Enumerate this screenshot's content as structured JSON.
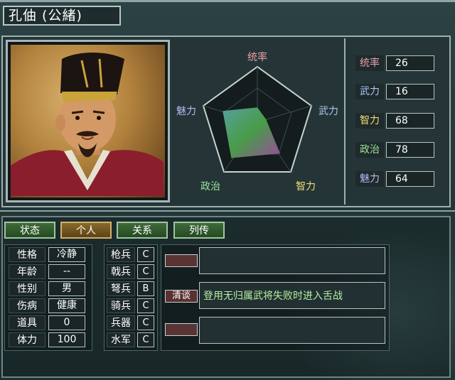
{
  "character": {
    "name": "孔伷 (公緒)"
  },
  "radar": {
    "axes": {
      "leadership": "统率",
      "war": "武力",
      "intelligence": "智力",
      "politics": "政治",
      "charm": "魅力"
    },
    "values": {
      "leadership": 26,
      "war": 16,
      "intelligence": 68,
      "politics": 78,
      "charm": 64
    }
  },
  "stats": [
    {
      "label": "统率",
      "value": "26",
      "color": "#e8a0a8"
    },
    {
      "label": "武力",
      "value": "16",
      "color": "#a8c8f0"
    },
    {
      "label": "智力",
      "value": "68",
      "color": "#f0dc78"
    },
    {
      "label": "政治",
      "value": "78",
      "color": "#9ee29a"
    },
    {
      "label": "魅力",
      "value": "64",
      "color": "#b7b7f0"
    }
  ],
  "tabs": [
    "状态",
    "个人",
    "关系",
    "列传"
  ],
  "active_tab": "个人",
  "personal": [
    {
      "label": "性格",
      "value": "冷静"
    },
    {
      "label": "年龄",
      "value": "--"
    },
    {
      "label": "性别",
      "value": "男"
    },
    {
      "label": "伤病",
      "value": "健康"
    },
    {
      "label": "道具",
      "value": "0"
    },
    {
      "label": "体力",
      "value": "100"
    }
  ],
  "units": [
    {
      "label": "枪兵",
      "value": "C"
    },
    {
      "label": "戟兵",
      "value": "C"
    },
    {
      "label": "弩兵",
      "value": "B"
    },
    {
      "label": "骑兵",
      "value": "C"
    },
    {
      "label": "兵器",
      "value": "C"
    },
    {
      "label": "水军",
      "value": "C"
    }
  ],
  "skills": [
    {
      "name": "",
      "description": ""
    },
    {
      "name": "清谈",
      "description": "登用无归属武将失败时进入舌战"
    },
    {
      "name": "",
      "description": ""
    }
  ],
  "colors": {
    "leadership": "#e8a0a8",
    "war": "#a8c8f0",
    "intelligence": "#f0dc78",
    "politics": "#9ee29a",
    "charm": "#b7b7f0"
  }
}
